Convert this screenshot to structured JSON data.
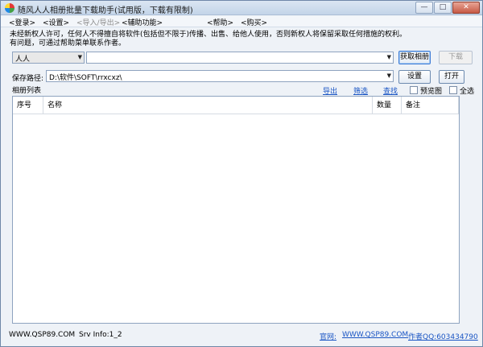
{
  "window": {
    "title": "随风人人相册批量下载助手(试用版，下载有限制)",
    "controls": {
      "minimize": "—",
      "maximize": "□",
      "close": "✕"
    }
  },
  "menu": [
    {
      "label": "<登录>",
      "enabled": true
    },
    {
      "label": "<设置>",
      "enabled": true
    },
    {
      "label": "<导入/导出>",
      "enabled": false
    },
    {
      "label": "<辅助功能>",
      "enabled": true
    },
    {
      "label": "<帮助>",
      "enabled": true
    },
    {
      "label": "<购买>",
      "enabled": true
    }
  ],
  "notice": {
    "line1": "未经新权人许可，任何人不得擅自将软件(包括但不限于)传播、出售、给他人使用，否则新权人将保留采取任何措施的权利。",
    "line2": "有问题，可通过帮助菜单联系作者。"
  },
  "source": {
    "site_value": "人人",
    "url_value": "",
    "get_album_label": "获取相册",
    "download_label": "下载"
  },
  "save": {
    "label": "保存路径:",
    "path_value": "D:\\软件\\SOFT\\rrxcxz\\",
    "settings_label": "设置",
    "open_label": "打开"
  },
  "album_list": {
    "title": "相册列表",
    "actions": {
      "export": "导出",
      "filter": "筛选",
      "find": "查找"
    },
    "preview_label": "预览图",
    "select_all_label": "全选",
    "preview_checked": false,
    "select_all_checked": false,
    "columns": [
      "序号",
      "名称",
      "数量",
      "备注"
    ],
    "rows": []
  },
  "status": {
    "site": "WWW.QSP89.COM",
    "srv_info": "Srv Info:1_2",
    "official_label": "官网:",
    "official_url": "WWW.QSP89.COM",
    "author_qq": "作者QQ:603434790"
  }
}
